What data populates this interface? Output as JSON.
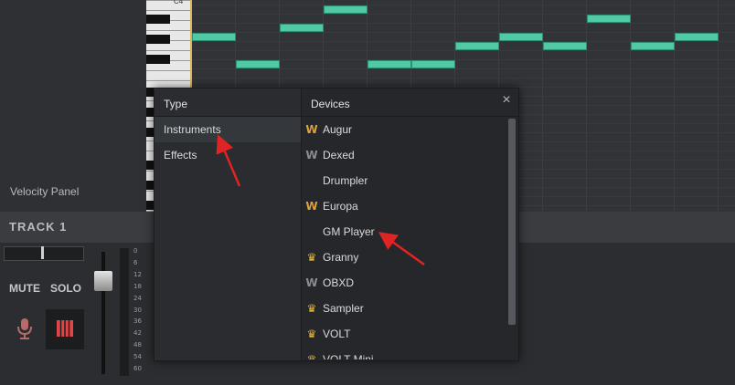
{
  "left_panel": {
    "velocity_label": "Velocity Panel"
  },
  "piano": {
    "octave_label": "C4"
  },
  "track": {
    "title": "TRACK 1",
    "mute_label": "MUTE",
    "solo_label": "SOLO"
  },
  "meter_scale": [
    "0",
    "6",
    "12",
    "18",
    "24",
    "30",
    "36",
    "42",
    "48",
    "54",
    "60"
  ],
  "dialog": {
    "type_header": "Type",
    "devices_header": "Devices",
    "close_symbol": "×",
    "types": [
      {
        "label": "Instruments",
        "selected": true
      },
      {
        "label": "Effects",
        "selected": false
      }
    ],
    "devices": [
      {
        "label": "Augur",
        "icon": "w-gold-icon"
      },
      {
        "label": "Dexed",
        "icon": "w-gray-icon"
      },
      {
        "label": "Drumpler",
        "icon": ""
      },
      {
        "label": "Europa",
        "icon": "w-gold-icon"
      },
      {
        "label": "GM Player",
        "icon": ""
      },
      {
        "label": "Granny",
        "icon": "crown-icon"
      },
      {
        "label": "OBXD",
        "icon": "w-gray-icon"
      },
      {
        "label": "Sampler",
        "icon": "crown-icon"
      },
      {
        "label": "VOLT",
        "icon": "crown-icon"
      },
      {
        "label": "VOLT Mini",
        "icon": "crown-icon"
      }
    ]
  },
  "colors": {
    "note": "#4fc9a6",
    "accent_gold": "#e0a23a",
    "annotation_arrow": "#e02424"
  }
}
